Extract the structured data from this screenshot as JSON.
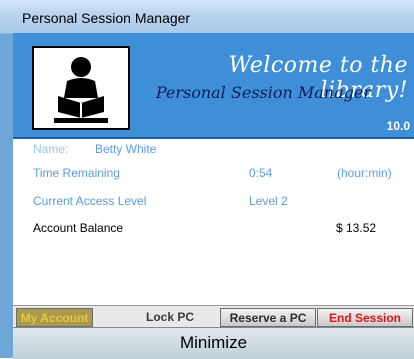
{
  "window": {
    "title": "Personal Session Manager"
  },
  "banner": {
    "welcome": "Welcome to the library!",
    "subtitle": "Personal Session Manager",
    "version": "10.0",
    "logo_icon": "reading-person-icon"
  },
  "account": {
    "name_label": "Name:",
    "name_value": "Betty White",
    "time_label": "Time Remaining",
    "time_value": "0:54",
    "time_unit": "(hour:min)",
    "access_label": "Current Access Level",
    "access_value": "Level 2",
    "balance_label": "Account Balance",
    "balance_value": "$ 13.52"
  },
  "tabs": [
    {
      "label": "My Account"
    },
    {
      "label": "Lock PC"
    },
    {
      "label": "Reserve a PC"
    },
    {
      "label": "End Session"
    }
  ],
  "minimize_label": "Minimize",
  "colors": {
    "banner": "#3f8fd8",
    "info_text": "#5e9be0",
    "end_session": "#e01414",
    "active_tab": "#a99a4d"
  }
}
